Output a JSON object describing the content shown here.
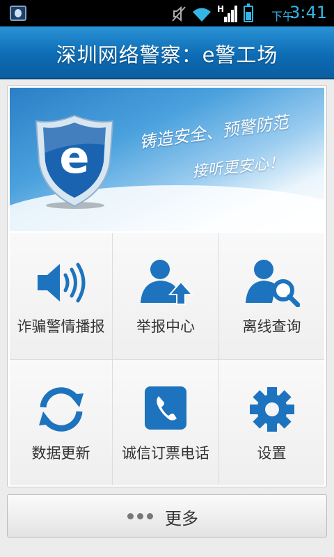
{
  "status_bar": {
    "ampm": "下午",
    "time": "3:41",
    "network_type": "H",
    "icons": [
      "app-shield-icon",
      "mute-icon",
      "wifi-icon",
      "signal-icon",
      "battery-icon"
    ],
    "color": "#33b5e5"
  },
  "header": {
    "title": "深圳网络警察：e警工场"
  },
  "banner": {
    "logo_letter": "e",
    "slogan_line1": "铸造安全、预警防范",
    "slogan_line2": "接听更安心！"
  },
  "grid": {
    "items": [
      {
        "label": "诈骗警情播报",
        "icon": "speaker-icon"
      },
      {
        "label": "举报中心",
        "icon": "user-upload-icon"
      },
      {
        "label": "离线查询",
        "icon": "user-search-icon"
      },
      {
        "label": "数据更新",
        "icon": "refresh-icon"
      },
      {
        "label": "诚信订票电话",
        "icon": "phone-icon"
      },
      {
        "label": "设置",
        "icon": "gear-icon"
      }
    ]
  },
  "more_button": {
    "label": "更多",
    "icon": "more-dots-icon"
  },
  "colors": {
    "accent": "#1478c4",
    "header_top": "#2a93d6",
    "header_bottom": "#0a5e9f"
  }
}
